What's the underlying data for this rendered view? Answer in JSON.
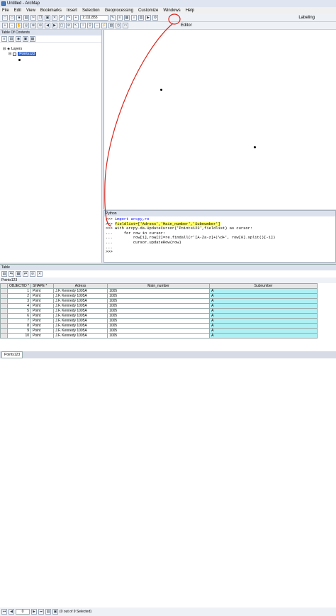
{
  "app": {
    "title": "Untitled - ArcMap"
  },
  "menu": [
    "File",
    "Edit",
    "View",
    "Bookmarks",
    "Insert",
    "Selection",
    "Geoprocessing",
    "Customize",
    "Windows",
    "Help"
  ],
  "toolbar": {
    "scale": "1:111,855",
    "editor_label": "Editor",
    "labeling_label": "Labeling"
  },
  "toc": {
    "title": "Table Of Contents",
    "layers_label": "Layers",
    "layer_name": "Points123"
  },
  "python": {
    "title": "Python",
    "lines": [
      {
        "prompt": ">>>",
        "code": "import arcpy,re"
      },
      {
        "prompt": ">>>",
        "code": "fieldlist=['Adress','Main_number','Subnumber']"
      },
      {
        "prompt": ">>>",
        "code": "with arcpy.da.UpdateCursor('Points123',fieldlist) as cursor:"
      },
      {
        "prompt": "...",
        "code": "    for row in cursor:"
      },
      {
        "prompt": "...",
        "code": "        row[1],row[2]=re.findall(r'[A-Za-z]+|\\d+', row[0].split()[-1])"
      },
      {
        "prompt": "...",
        "code": "        cursor.updateRow(row)"
      },
      {
        "prompt": "...",
        "code": ""
      },
      {
        "prompt": ">>>",
        "code": ""
      }
    ]
  },
  "table": {
    "title": "Table",
    "tab_name": "Points123",
    "columns": [
      "OBJECTID *",
      "SHAPE *",
      "Adress",
      "Main_number",
      "Subnumber"
    ],
    "rows": [
      [
        "1",
        "Point",
        "J.F. Kennedy 1005A",
        "1005",
        "A"
      ],
      [
        "2",
        "Point",
        "J.F. Kennedy 1005A",
        "1005",
        "A"
      ],
      [
        "3",
        "Point",
        "J.F. Kennedy 1005A",
        "1005",
        "A"
      ],
      [
        "4",
        "Point",
        "J.F. Kennedy 1005A",
        "1005",
        "A"
      ],
      [
        "5",
        "Point",
        "J.F. Kennedy 1005A",
        "1005",
        "A"
      ],
      [
        "6",
        "Point",
        "J.F. Kennedy 1005A",
        "1005",
        "A"
      ],
      [
        "7",
        "Point",
        "J.F. Kennedy 1005A",
        "1005",
        "A"
      ],
      [
        "8",
        "Point",
        "J.F. Kennedy 1005A",
        "1005",
        "A"
      ],
      [
        "9",
        "Point",
        "J.F. Kennedy 1005A",
        "1005",
        "A"
      ],
      [
        "10",
        "Point",
        "J.F. Kennedy 1005A",
        "1005",
        "A"
      ]
    ],
    "page_value": "0",
    "selection_status": "(0 out of 9 Selected)"
  },
  "bottom_tab": "Points123",
  "colors": {
    "highlight": "#ffff66",
    "subnumber_cell": "#aef0f4",
    "annotation": "#d9261c"
  }
}
